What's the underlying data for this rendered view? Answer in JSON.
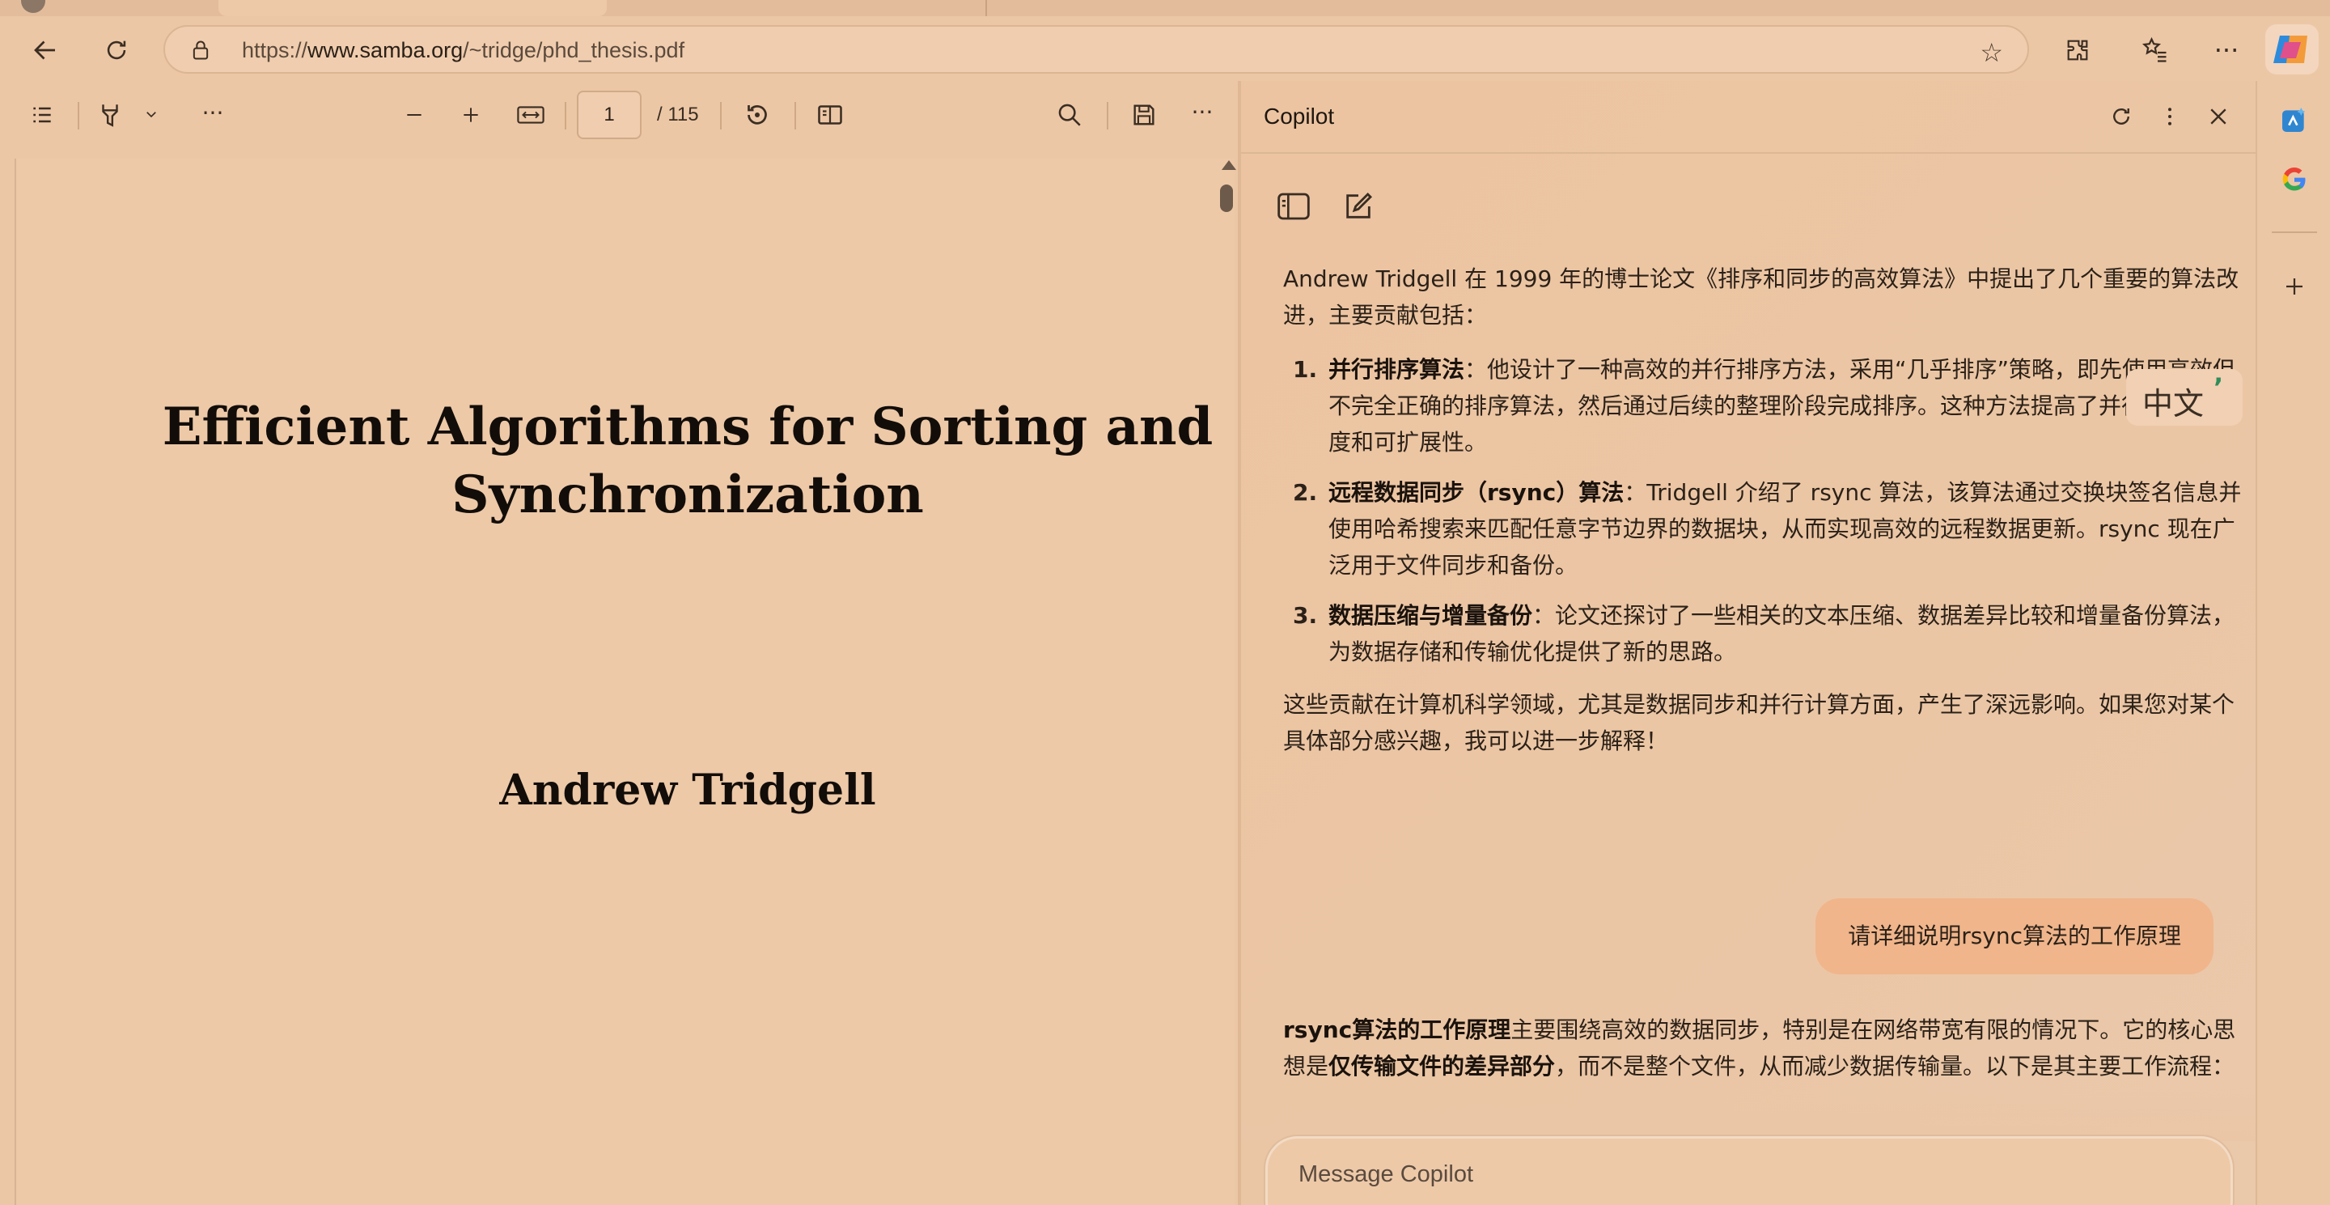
{
  "browser": {
    "address": {
      "url_prefix": "https://",
      "url_domain": "www.samba.org",
      "url_path": "/~tridge/phd_thesis.pdf"
    }
  },
  "pdf_toolbar": {
    "current_page": "1",
    "total_pages": "/ 115"
  },
  "pdf": {
    "title_line1": "Efficient Algorithms for Sorting and",
    "title_line2": "Synchronization",
    "author": "Andrew Tridgell"
  },
  "copilot": {
    "title": "Copilot",
    "intro": "Andrew Tridgell 在 1999 年的博士论文《排序和同步的高效算法》中提出了几个重要的算法改进，主要贡献包括：",
    "items": [
      {
        "num": "1.",
        "heading": "并行排序算法",
        "text": "：他设计了一种高效的并行排序方法，采用“几乎排序”策略，即先使用高效但不完全正确的排序算法，然后通过后续的整理阶段完成排序。这种方法提高了并行排序的速度和可扩展性。"
      },
      {
        "num": "2.",
        "heading": "远程数据同步（rsync）算法",
        "text": "：Tridgell 介绍了 rsync 算法，该算法通过交换块签名信息并使用哈希搜索来匹配任意字节边界的数据块，从而实现高效的远程数据更新。rsync 现在广泛用于文件同步和备份。"
      },
      {
        "num": "3.",
        "heading": "数据压缩与增量备份",
        "text": "：论文还探讨了一些相关的文本压缩、数据差异比较和增量备份算法，为数据存储和传输优化提供了新的思路。"
      }
    ],
    "closing": "这些贡献在计算机科学领域，尤其是数据同步和并行计算方面，产生了深远影响。如果您对某个具体部分感兴趣，我可以进一步解释！",
    "user_message": "请详细说明rsync算法的工作原理",
    "reply_heading": "rsync算法的工作原理",
    "reply_part1": "主要围绕高效的数据同步，特别是在网络带宽有限的情况下。它的核心思想是",
    "reply_strong": "仅传输文件的差异部分",
    "reply_part2": "，而不是整个文件，从而减少数据传输量。以下是其主要工作流程：",
    "input_placeholder": "Message Copilot"
  },
  "translate_overlay": {
    "label": "中文",
    "mark": "’"
  }
}
